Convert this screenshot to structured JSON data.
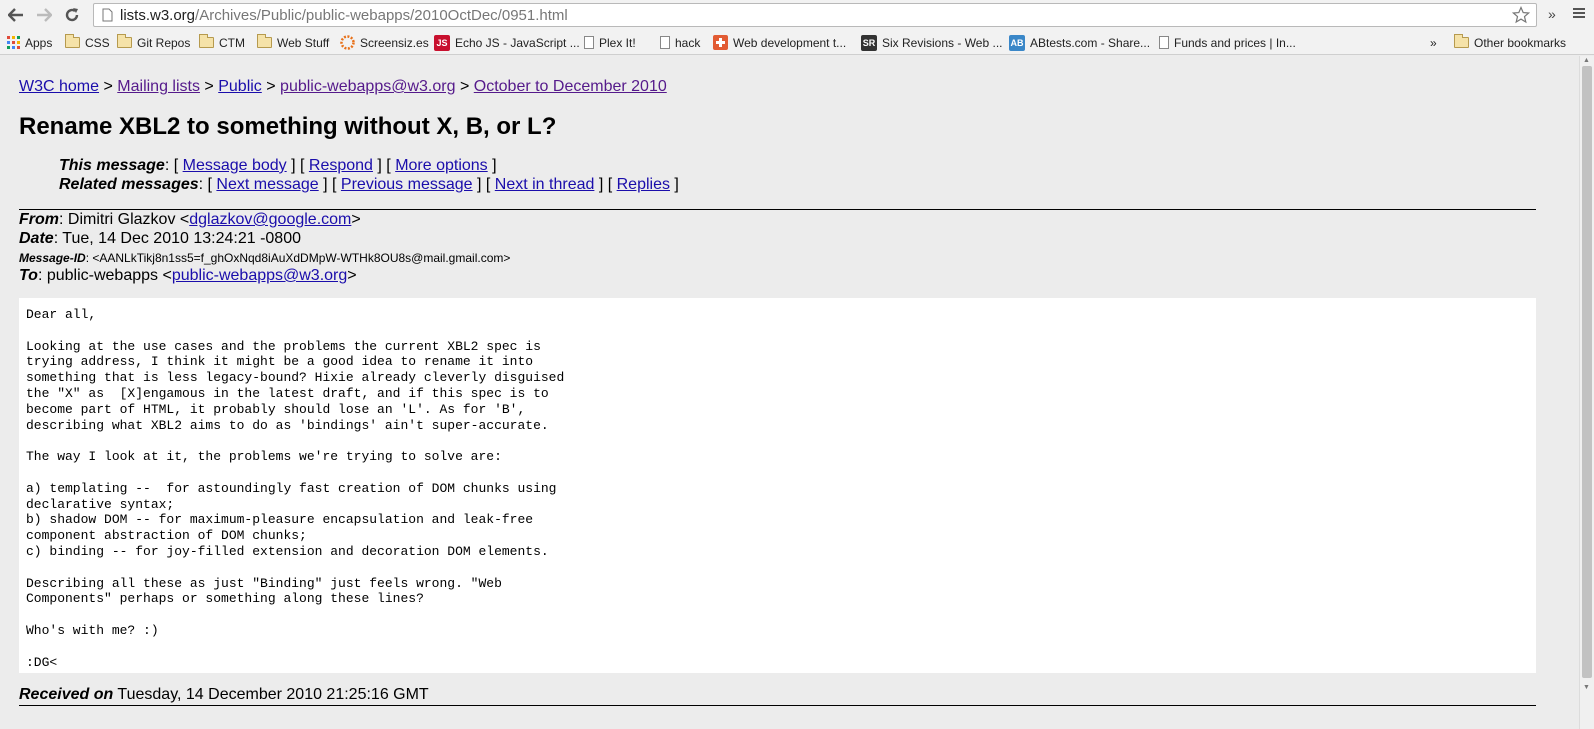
{
  "browser": {
    "url_host": "lists.w3.org",
    "url_path": "/Archives/Public/public-webapps/2010OctDec/0951.html",
    "bookmarks": [
      {
        "label": "Apps",
        "icon": "apps-grid-icon"
      },
      {
        "label": "CSS",
        "icon": "folder-icon"
      },
      {
        "label": "Git Repos",
        "icon": "folder-icon"
      },
      {
        "label": "CTM",
        "icon": "folder-icon"
      },
      {
        "label": "Web Stuff",
        "icon": "folder-icon"
      },
      {
        "label": "Screensiz.es",
        "icon": "screensiz-icon"
      },
      {
        "label": "Echo JS - JavaScript ...",
        "icon": "echojs-icon",
        "badge": "JS"
      },
      {
        "label": "Plex It!",
        "icon": "page-icon"
      },
      {
        "label": "hack",
        "icon": "page-icon"
      },
      {
        "label": "Web development t...",
        "icon": "plus-icon"
      },
      {
        "label": "Six Revisions - Web ...",
        "icon": "sixrevisions-icon",
        "badge": "SR"
      },
      {
        "label": "ABtests.com - Share...",
        "icon": "abtests-icon",
        "badge": "AB"
      },
      {
        "label": "Funds and prices | In...",
        "icon": "page-icon"
      }
    ],
    "overflow": "»",
    "other_bookmarks": "Other bookmarks"
  },
  "breadcrumb": {
    "items": [
      "W3C home",
      "Mailing lists",
      "Public",
      "public-webapps@w3.org",
      "October to December 2010"
    ],
    "separator": ">"
  },
  "title": "Rename XBL2 to something without X, B, or L?",
  "this_message": {
    "label": "This message",
    "links": [
      "Message body",
      "Respond",
      "More options"
    ]
  },
  "related_messages": {
    "label": "Related messages",
    "links": [
      "Next message",
      "Previous message",
      "Next in thread",
      "Replies"
    ]
  },
  "headers": {
    "from_label": "From",
    "from_name": "Dimitri Glazkov",
    "from_email": "dglazkov@google.com",
    "date_label": "Date",
    "date_value": "Tue, 14 Dec 2010 13:24:21 -0800",
    "msgid_label": "Message-ID",
    "msgid_value": "<AANLkTikj8n1ss5=f_ghOxNqd8iAuXdDMpW-WTHk8OU8s@mail.gmail.com>",
    "to_label": "To",
    "to_name": "public-webapps",
    "to_email": "public-webapps@w3.org"
  },
  "body": "Dear all,\n\nLooking at the use cases and the problems the current XBL2 spec is\ntrying address, I think it might be a good idea to rename it into\nsomething that is less legacy-bound? Hixie already cleverly disguised\nthe \"X\" as  [X]engamous in the latest draft, and if this spec is to\nbecome part of HTML, it probably should lose an 'L'. As for 'B',\ndescribing what XBL2 aims to do as 'bindings' ain't super-accurate.\n\nThe way I look at it, the problems we're trying to solve are:\n\na) templating --  for astoundingly fast creation of DOM chunks using\ndeclarative syntax;\nb) shadow DOM -- for maximum-pleasure encapsulation and leak-free\ncomponent abstraction of DOM chunks;\nc) binding -- for joy-filled extension and decoration DOM elements.\n\nDescribing all these as just \"Binding\" just feels wrong. \"Web\nComponents\" perhaps or something along these lines?\n\nWho's with me? :)\n\n:DG<",
  "received": {
    "label": "Received on",
    "value": "Tuesday, 14 December 2010 21:25:16 GMT"
  }
}
